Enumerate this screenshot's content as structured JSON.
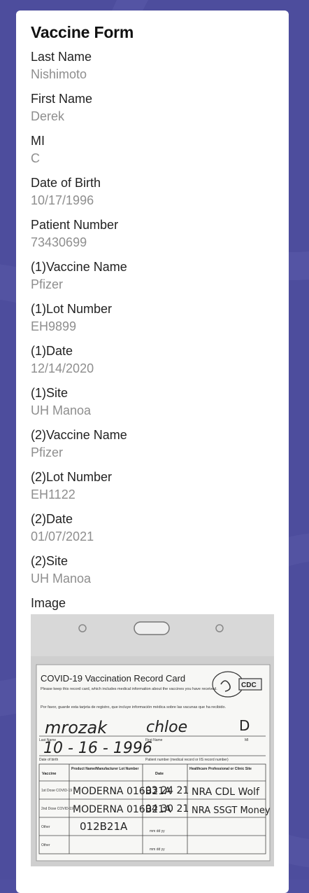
{
  "form": {
    "title": "Vaccine Form",
    "fields": [
      {
        "label": "Last Name",
        "value": "Nishimoto"
      },
      {
        "label": "First Name",
        "value": "Derek"
      },
      {
        "label": "MI",
        "value": "C"
      },
      {
        "label": "Date of Birth",
        "value": "10/17/1996"
      },
      {
        "label": "Patient Number",
        "value": "73430699"
      },
      {
        "label": "(1)Vaccine Name",
        "value": "Pfizer"
      },
      {
        "label": "(1)Lot Number",
        "value": "EH9899"
      },
      {
        "label": "(1)Date",
        "value": "12/14/2020"
      },
      {
        "label": "(1)Site",
        "value": "UH Manoa"
      },
      {
        "label": "(2)Vaccine Name",
        "value": "Pfizer"
      },
      {
        "label": "(2)Lot Number",
        "value": "EH1122"
      },
      {
        "label": "(2)Date",
        "value": "01/07/2021"
      },
      {
        "label": "(2)Site",
        "value": "UH Manoa"
      }
    ],
    "image_label": "Image"
  },
  "card_image": {
    "title": "COVID-19 Vaccination Record Card",
    "badge": "CDC",
    "note_en": "Please keep this record card, which includes medical information about the vaccines you have received.",
    "note_es": "Por favor, guarde esta tarjeta de registro, que incluye información médica sobre las vacunas que ha recibido.",
    "last_name_caption": "Last Name",
    "first_name_caption": "First Name",
    "mi_caption": "MI",
    "dob_caption": "Date of birth",
    "patient_caption": "Patient number (medical record or IIS record number)",
    "hw_last": "mrozak",
    "hw_first": "chloe",
    "hw_mi": "D",
    "hw_dob": "10 - 16 - 1996",
    "table_headers": [
      "Vaccine",
      "Product Name/Manufacturer Lot Number",
      "Date",
      "Healthcare Professional or Clinic Site"
    ],
    "rows": [
      {
        "vaccine": "1st Dose COVID-19",
        "product": "MODERNA 016B21A",
        "date": "03 24 21",
        "site": "NRA CDL Wolf"
      },
      {
        "vaccine": "2nd Dose COVID-19",
        "product": "MODERNA 016B21A",
        "date": "04 30 21",
        "site": "NRA SSGT Money"
      },
      {
        "vaccine": "Other",
        "product": "012B21A",
        "date": "mm dd yy",
        "site": ""
      },
      {
        "vaccine": "Other",
        "product": "",
        "date": "mm dd yy",
        "site": ""
      }
    ]
  },
  "colors": {
    "background": "#4d4d9d",
    "card": "#ffffff",
    "value_text": "#8e8e8e"
  }
}
